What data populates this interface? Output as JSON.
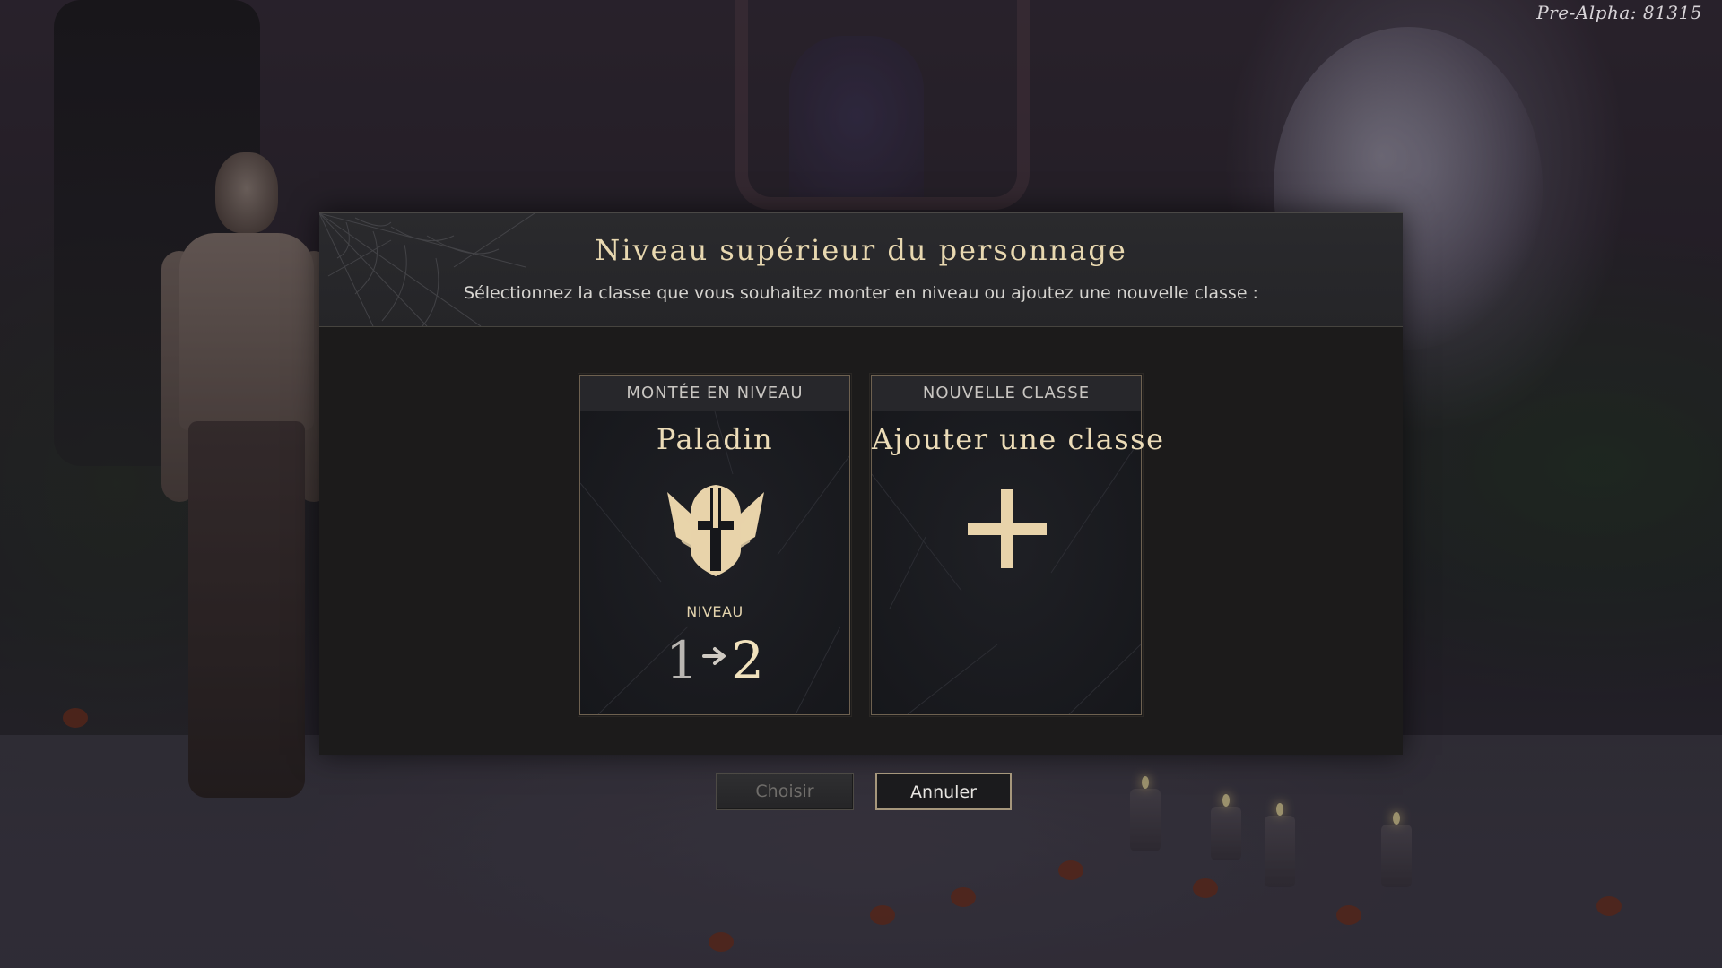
{
  "version": "Pre-Alpha: 81315",
  "dialog": {
    "title": "Niveau supérieur du personnage",
    "subtitle": "Sélectionnez la classe que vous souhaitez monter en niveau ou ajoutez une nouvelle classe :"
  },
  "cards": {
    "level_up": {
      "tab_label": "MONTÉE EN NIVEAU",
      "class_name": "Paladin",
      "emblem_icon": "paladin-helmet-icon",
      "level_label": "NIVEAU",
      "level_from": "1",
      "level_to": "2"
    },
    "new_class": {
      "tab_label": "NOUVELLE CLASSE",
      "title": "Ajouter une classe",
      "emblem_icon": "plus-icon"
    }
  },
  "buttons": {
    "choose": "Choisir",
    "cancel": "Annuler"
  },
  "colors": {
    "accent_gold": "#ecdcb8",
    "card_border": "#6e6150",
    "button_border": "#a6977c"
  }
}
